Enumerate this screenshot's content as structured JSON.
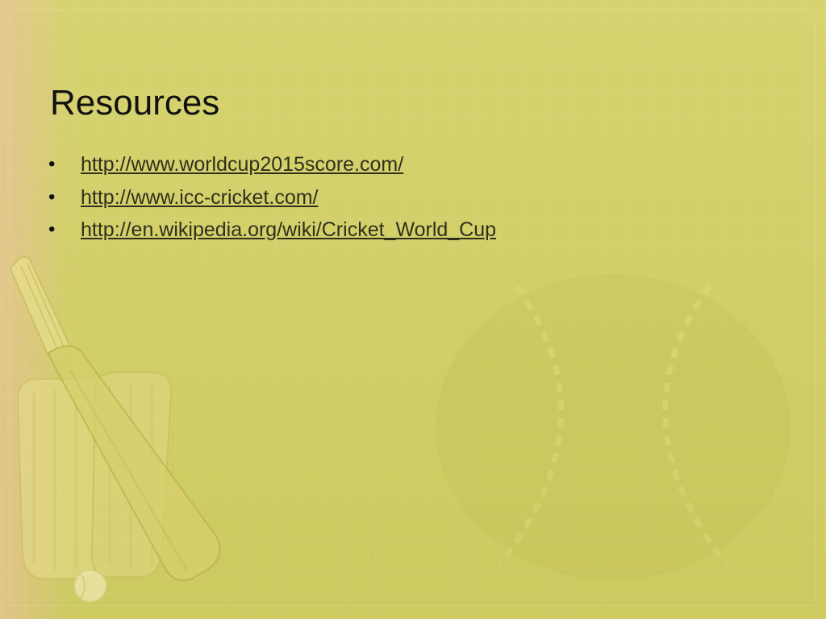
{
  "slide": {
    "title": "Resources",
    "bullet_symbol": "•",
    "links": [
      {
        "text": "http://www.worldcup2015score.com/"
      },
      {
        "text": "http://www.icc-cricket.com/"
      },
      {
        "text": "http://en.wikipedia.org/wiki/Cricket_World_Cup"
      }
    ]
  },
  "background": {
    "base_color": "#d3d064",
    "edge_tint_color": "#f0beaa",
    "decoration_icons": [
      "cricket-bat-icon",
      "batting-pads-icon",
      "cricket-ball-icon",
      "cricket-ball-seam-icon"
    ]
  },
  "colors": {
    "title_text": "#111111",
    "link_text": "#2f2f1c"
  }
}
